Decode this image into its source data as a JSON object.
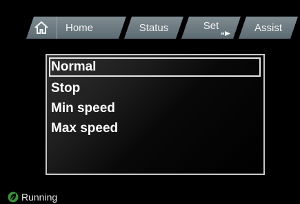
{
  "tabs": {
    "home": "Home",
    "status": "Status",
    "set": "Set",
    "assist": "Assist"
  },
  "menu": {
    "items": [
      "Normal",
      "Stop",
      "Min speed",
      "Max speed"
    ],
    "selected_index": 0
  },
  "status": {
    "text": "Running",
    "icon": "running-icon",
    "icon_color": "#3c8f3c"
  },
  "colors": {
    "tab": "#6d7b82",
    "background": "#000000",
    "text": "#ffffff"
  }
}
